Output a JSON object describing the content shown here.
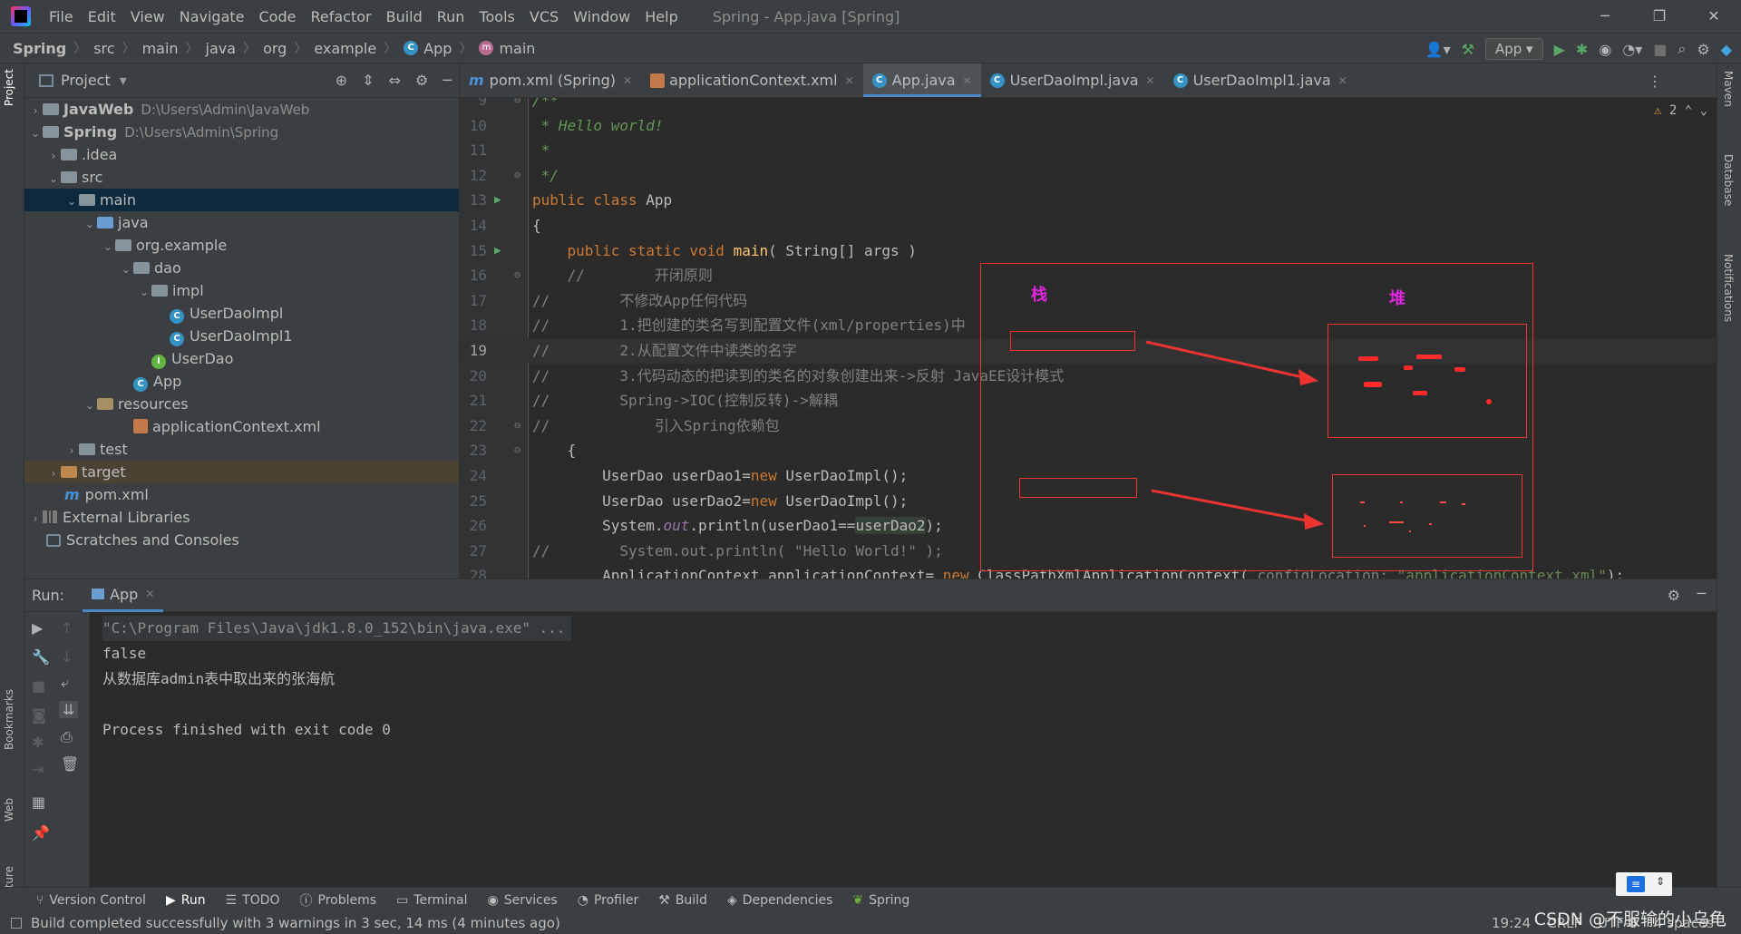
{
  "menubar": {
    "items": [
      "File",
      "Edit",
      "View",
      "Navigate",
      "Code",
      "Refactor",
      "Build",
      "Run",
      "Tools",
      "VCS",
      "Window",
      "Help"
    ],
    "title": "Spring - App.java [Spring]"
  },
  "breadcrumb": [
    "Spring",
    "src",
    "main",
    "java",
    "org",
    "example",
    "App",
    "main"
  ],
  "run_config": "App",
  "project_panel": {
    "title": "Project",
    "tree": [
      {
        "label": "JavaWeb",
        "path": "D:\\Users\\Admin\\JavaWeb"
      },
      {
        "label": "Spring",
        "path": "D:\\Users\\Admin\\Spring"
      },
      {
        "label": ".idea"
      },
      {
        "label": "src"
      },
      {
        "label": "main"
      },
      {
        "label": "java"
      },
      {
        "label": "org.example"
      },
      {
        "label": "dao"
      },
      {
        "label": "impl"
      },
      {
        "label": "UserDaoImpl"
      },
      {
        "label": "UserDaoImpl1"
      },
      {
        "label": "UserDao"
      },
      {
        "label": "App"
      },
      {
        "label": "resources"
      },
      {
        "label": "applicationContext.xml"
      },
      {
        "label": "test"
      },
      {
        "label": "target"
      },
      {
        "label": "pom.xml"
      },
      {
        "label": "External Libraries"
      },
      {
        "label": "Scratches and Consoles"
      }
    ]
  },
  "editor_tabs": [
    "pom.xml (Spring)",
    "applicationContext.xml",
    "App.java",
    "UserDaoImpl.java",
    "UserDaoImpl1.java"
  ],
  "editor": {
    "warnings": "2",
    "lines": [
      {
        "n": "9",
        "text": "/**"
      },
      {
        "n": "10",
        "text": " * Hello world!"
      },
      {
        "n": "11",
        "text": " *"
      },
      {
        "n": "12",
        "text": " */"
      },
      {
        "n": "13",
        "kw": "public class",
        "rest": " App"
      },
      {
        "n": "14",
        "text": "{"
      },
      {
        "n": "15",
        "kw": "    public static void",
        "fn": "main",
        "rest": "( String[] args )"
      },
      {
        "n": "16",
        "text": "    //        开闭原则"
      },
      {
        "n": "17",
        "text": "//        不修改App任何代码"
      },
      {
        "n": "18",
        "text": "//        1.把创建的类名写到配置文件(xml/properties)中"
      },
      {
        "n": "19",
        "text": "//        2.从配置文件中读类的名字"
      },
      {
        "n": "20",
        "text": "//        3.代码动态的把读到的类名的对象创建出来->反射 JavaEE设计模式"
      },
      {
        "n": "21",
        "text": "//        Spring->IOC(控制反转)->解耦"
      },
      {
        "n": "22",
        "text": "//            引入Spring依赖包"
      },
      {
        "n": "23",
        "text": "    {"
      },
      {
        "n": "24",
        "a": "        UserDao userDao1=",
        "kw": "new",
        "b": " UserDaoImpl();"
      },
      {
        "n": "25",
        "a": "        UserDao userDao2=",
        "kw": "new",
        "b": " UserDaoImpl();"
      },
      {
        "n": "26",
        "a": "        System.",
        "field": "out",
        "b": ".println(userDao1==",
        "hl": "userDao2",
        "c": ");"
      },
      {
        "n": "27",
        "text": "//        System.out.println( \"Hello World!\" );"
      },
      {
        "n": "28",
        "a": "        ApplicationContext applicationContext= ",
        "kw": "new",
        "b": " ClassPathXmlApplicationContext(",
        "hint": " configLocation: ",
        "str": "\"applicationContext.xml\"",
        "c": ");"
      }
    ]
  },
  "annotation": {
    "stack_label": "栈",
    "heap_label": "堆"
  },
  "run_panel": {
    "label": "Run:",
    "tab": "App",
    "console": [
      "\"C:\\Program Files\\Java\\jdk1.8.0_152\\bin\\java.exe\" ...",
      "false",
      "从数据库admin表中取出来的张海航",
      "",
      "Process finished with exit code 0"
    ]
  },
  "bottom_tools": [
    "Version Control",
    "Run",
    "TODO",
    "Problems",
    "Terminal",
    "Services",
    "Profiler",
    "Build",
    "Dependencies",
    "Spring"
  ],
  "status": {
    "message": "Build completed successfully with 3 warnings in 3 sec, 14 ms (4 minutes ago)",
    "position": "19:24",
    "line_ending": "CRLF",
    "encoding": "UTF-8",
    "indent": "4 spaces"
  },
  "left_strip": [
    "Project",
    "Bookmarks",
    "Web",
    "Structure"
  ],
  "right_strip": [
    "Maven",
    "Database",
    "Notifications"
  ],
  "watermark": "CSDN @不服输的小乌龟"
}
